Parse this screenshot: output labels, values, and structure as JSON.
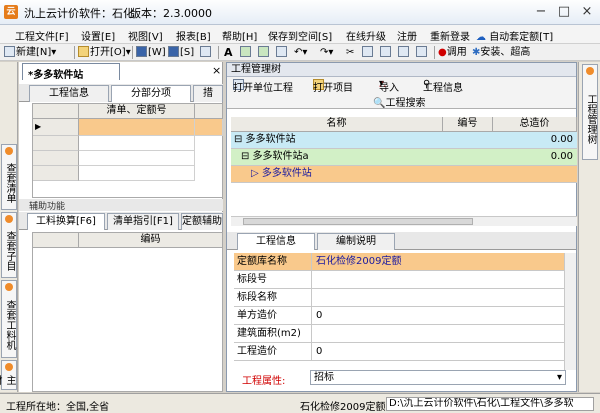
{
  "window": {
    "title": "氿上云计价软件：石化",
    "version_label": "版本：2.3.0000",
    "minimize": "−",
    "maximize": "□",
    "close": "×"
  },
  "menu": [
    "工程文件[F]",
    "设置[E]",
    "视图[V]",
    "报表[B]",
    "帮助[H]",
    "保存到空间[S]",
    "在线升级",
    "注册",
    "重新登录",
    "自动套定额[T]"
  ],
  "toolbar": {
    "new": "新建[N]",
    "open": "打开[O]",
    "save_key": "[W]",
    "saveas_key": "[S]",
    "font_glyph": "A",
    "price_btn": "调用",
    "install_btn": "安装、超高"
  },
  "left_tabs": [
    "查套清单",
    "查套子目",
    "查套工料机",
    "主材设备独立"
  ],
  "right_tabs": [
    "工程管理树"
  ],
  "doc_tab": "*多多软件站",
  "sub_tabs": [
    "工程信息",
    "分部分项",
    "措"
  ],
  "grid1": {
    "columns": [
      "清单、定额号"
    ]
  },
  "aux_label": "辅助功能",
  "aux_tabs": [
    "工料换算[F6]",
    "清单指引[F1]",
    "定额辅助"
  ],
  "grid2": {
    "columns": [
      "编码"
    ]
  },
  "project_tree": {
    "title": "工程管理树",
    "toolbar": [
      "打开单位工程",
      "打开项目",
      "导入",
      "工程信息"
    ],
    "search": "工程搜索",
    "columns": [
      "名称",
      "编号",
      "总造价"
    ],
    "rows": [
      {
        "name": "⊟ 多多软件站",
        "code": "",
        "total": "0.00",
        "color": "#c8eaf5"
      },
      {
        "name": "⊟ 多多软件站a",
        "code": "",
        "total": "0.00",
        "color": "#d2f0c6"
      },
      {
        "name": "▷ 多多软件站",
        "code": "",
        "total": "",
        "color": "#f9c98c"
      }
    ]
  },
  "info_tabs": [
    "工程信息",
    "编制说明"
  ],
  "properties": [
    {
      "key": "定额库名称",
      "value": "石化检修2009定额"
    },
    {
      "key": "标段号",
      "value": ""
    },
    {
      "key": "标段名称",
      "value": ""
    },
    {
      "key": "单方造价",
      "value": "0"
    },
    {
      "key": "建筑面积(m2)",
      "value": ""
    },
    {
      "key": "工程造价",
      "value": "0"
    }
  ],
  "project_attr": {
    "key": "工程属性:",
    "value": "招标"
  },
  "status": {
    "location": "工程所在地：全国,全省",
    "quota": "石化检修2009定额",
    "path": "D:\\氿上云计价软件\\石化\\工程文件\\多多软"
  },
  "colors": {
    "accent_orange": "#f9c98c",
    "tree_blue": "#c8eaf5",
    "tree_green": "#d2f0c6",
    "red_label": "#d00000"
  }
}
